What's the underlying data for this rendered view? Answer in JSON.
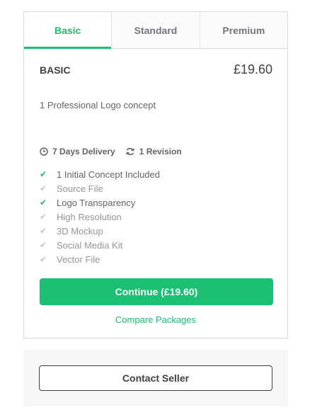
{
  "tabs": [
    {
      "label": "Basic",
      "active": true
    },
    {
      "label": "Standard",
      "active": false
    },
    {
      "label": "Premium",
      "active": false
    }
  ],
  "package": {
    "name": "BASIC",
    "price": "£19.60",
    "description": "1 Professional Logo concept"
  },
  "meta": {
    "delivery": "7 Days Delivery",
    "revisions": "1 Revision"
  },
  "features": [
    {
      "label": "1 Initial Concept Included",
      "included": true
    },
    {
      "label": "Source File",
      "included": false
    },
    {
      "label": "Logo Transparency",
      "included": true
    },
    {
      "label": "High Resolution",
      "included": false
    },
    {
      "label": "3D Mockup",
      "included": false
    },
    {
      "label": "Social Media Kit",
      "included": false
    },
    {
      "label": "Vector File",
      "included": false
    }
  ],
  "actions": {
    "continue_label": "Continue (£19.60)",
    "compare_label": "Compare Packages",
    "contact_label": "Contact Seller"
  },
  "colors": {
    "accent": "#1dbf73",
    "text": "#404145",
    "muted": "#95979d"
  },
  "icons": {
    "delivery": "clock-icon",
    "revision": "refresh-icon",
    "feature": "check-icon"
  }
}
